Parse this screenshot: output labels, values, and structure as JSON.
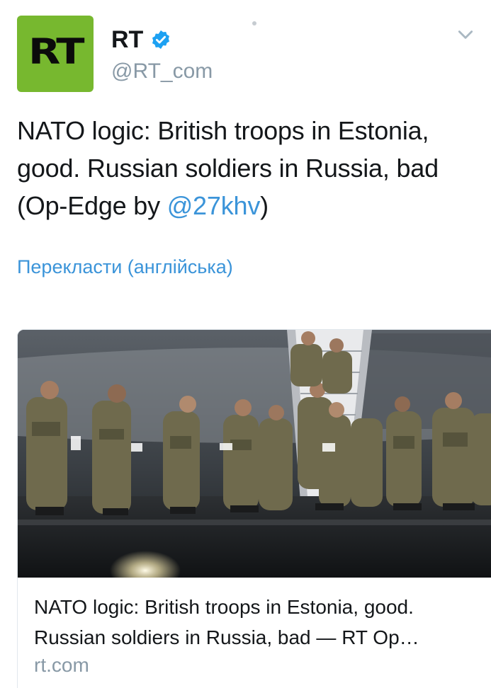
{
  "tweet": {
    "author_name": "RT",
    "author_handle": "@RT_com",
    "avatar_text": "RT",
    "verified": true,
    "text_before_mention": "NATO logic: British troops in Estonia, good. Russian soldiers in Russia, bad (Op-Edge by ",
    "mention": "@27khv",
    "text_after_mention": ")",
    "translate_label": "Перекласти (англійська)"
  },
  "card": {
    "title": "NATO logic: British troops in Estonia, good. Russian soldiers in Russia, bad — RT Op…",
    "domain": "rt.com"
  },
  "colors": {
    "avatar_bg": "#77b82f",
    "link": "#3b94d9",
    "secondary": "#8899a6",
    "verified_badge": "#1da1f2"
  },
  "icons": {
    "verified": "verified-badge-icon",
    "menu": "chevron-down-icon"
  }
}
